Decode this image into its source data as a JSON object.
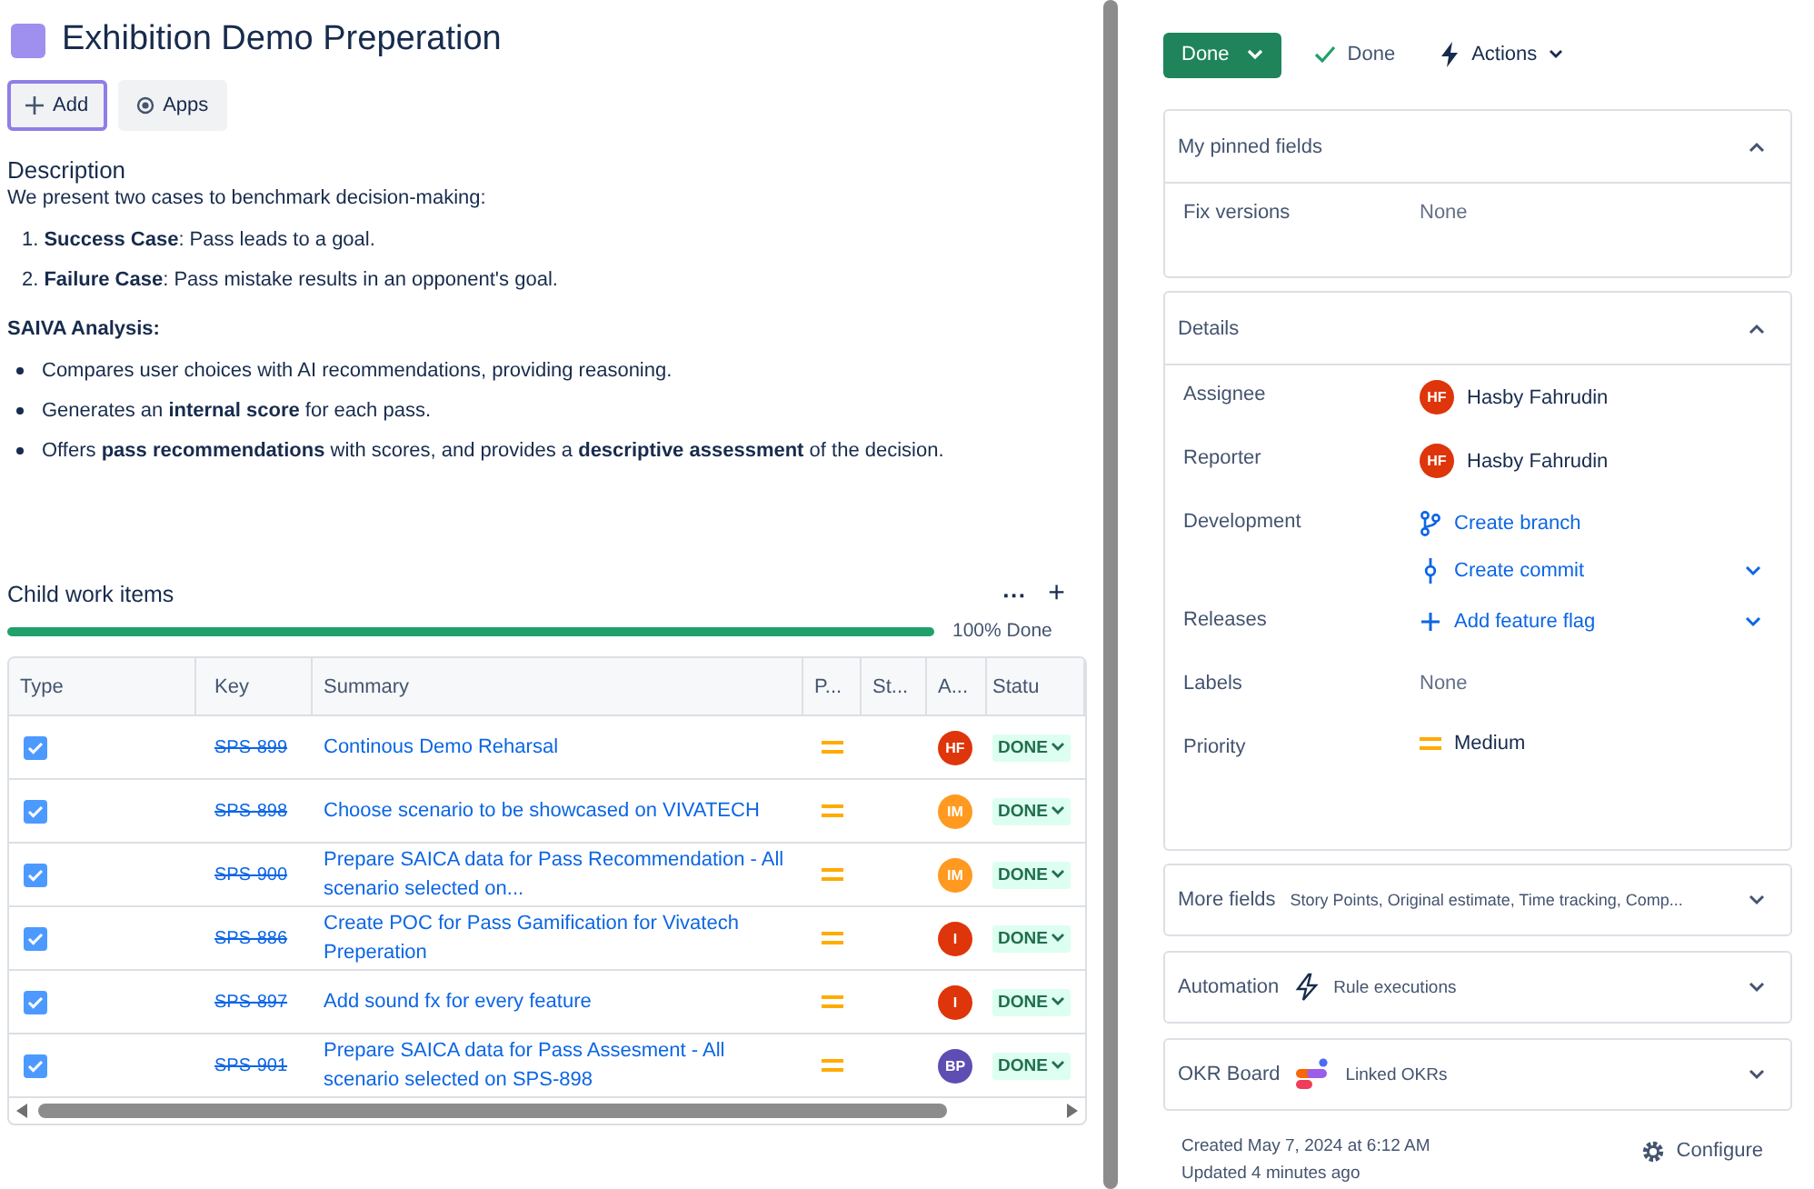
{
  "title": "Exhibition Demo Preperation",
  "toolbar": [
    {
      "label": "Add",
      "kind": "add",
      "selected": true
    },
    {
      "label": "Apps",
      "kind": "apps",
      "selected": false
    }
  ],
  "description": {
    "heading": "Description",
    "intro": "We present two cases to benchmark decision-making:",
    "cases": [
      {
        "number": "1.",
        "text": "**Success Case**: Pass leads to a goal."
      },
      {
        "number": "2.",
        "text": "**Failure Case**: Pass mistake results in an opponent's goal."
      }
    ],
    "analysis_heading": "SAIVA Analysis:",
    "bullets": [
      "Compares user choices with AI recommendations, providing reasoning.",
      "Generates an **internal score** for each pass.",
      "Offers **pass recommendations** with scores, and provides a **descriptive assessment** of the decision."
    ]
  },
  "child_items": {
    "heading": "Child work items",
    "more": "···",
    "add": "+",
    "progress": {
      "level": 1,
      "label": "100% Done"
    },
    "columns": [
      "Type",
      "Key",
      "Summary",
      "P...",
      "St...",
      "A...",
      "Statu"
    ],
    "rows": [
      {
        "checked": true,
        "key": "SPS-899",
        "resolved": true,
        "summary": "Continous Demo Reharsal",
        "assignee": "HF",
        "color": "#de350b",
        "status": "DONE"
      },
      {
        "checked": true,
        "key": "SPS-898",
        "resolved": true,
        "summary": "Choose scenario to be showcased on VIVATECH",
        "assignee": "IM",
        "color": "#ff991f",
        "status": "DONE"
      },
      {
        "checked": true,
        "key": "SPS-900",
        "resolved": true,
        "summary": "Prepare SAICA data for Pass Recommendation - All scenario selected on...",
        "assignee": "IM",
        "color": "#ff991f",
        "status": "DONE"
      },
      {
        "checked": true,
        "key": "SPS-886",
        "resolved": true,
        "summary": "Create POC for Pass Gamification for Vivatech Preperation",
        "assignee": "I",
        "color": "#de350b",
        "status": "DONE"
      },
      {
        "checked": true,
        "key": "SPS-897",
        "resolved": true,
        "summary": "Add sound fx for every feature",
        "assignee": "I",
        "color": "#de350b",
        "status": "DONE"
      },
      {
        "checked": true,
        "key": "SPS-901",
        "resolved": true,
        "summary": "Prepare SAICA data for Pass Assesment - All scenario selected on SPS-898",
        "assignee": "BP",
        "color": "#5e4db2",
        "status": "DONE"
      }
    ]
  },
  "status_button": "Done",
  "resolution": "Done",
  "actions": "Actions",
  "pinned": {
    "title": "My pinned fields",
    "expanded": true,
    "fields": [
      {
        "kind": "none",
        "label": "Fix versions",
        "value": "None"
      }
    ]
  },
  "details": {
    "title": "Details",
    "expanded": true,
    "fields": [
      {
        "kind": "person",
        "label": "Assignee",
        "value": "Hasby Fahrudin",
        "initials": "HF"
      },
      {
        "kind": "person",
        "label": "Reporter",
        "value": "Hasby Fahrudin",
        "initials": "HF"
      },
      {
        "kind": "links",
        "label": "Development",
        "links": [
          {
            "kind": "branch",
            "text": "Create branch"
          },
          {
            "kind": "commit",
            "text": "Create commit"
          }
        ]
      },
      {
        "kind": "links",
        "label": "Releases",
        "links": [
          {
            "kind": "add",
            "text": "Add feature flag"
          }
        ]
      },
      {
        "kind": "none",
        "label": "Labels",
        "value": "None"
      },
      {
        "kind": "priority",
        "label": "Priority",
        "value": "Medium"
      }
    ]
  },
  "sections": [
    {
      "kind": "more",
      "title": "More fields",
      "summary": "Story Points, Original estimate, Time tracking, Comp...",
      "expanded": false
    },
    {
      "kind": "automation",
      "title": "Automation",
      "summary": "Rule executions",
      "expanded": false
    },
    {
      "kind": "okr",
      "title": "OKR Board",
      "summary": "Linked OKRs",
      "expanded": false
    }
  ],
  "footer": {
    "created": "Created May 7, 2024 at 6:12 AM",
    "updated": "Updated 4 minutes ago",
    "configure": "Configure"
  }
}
